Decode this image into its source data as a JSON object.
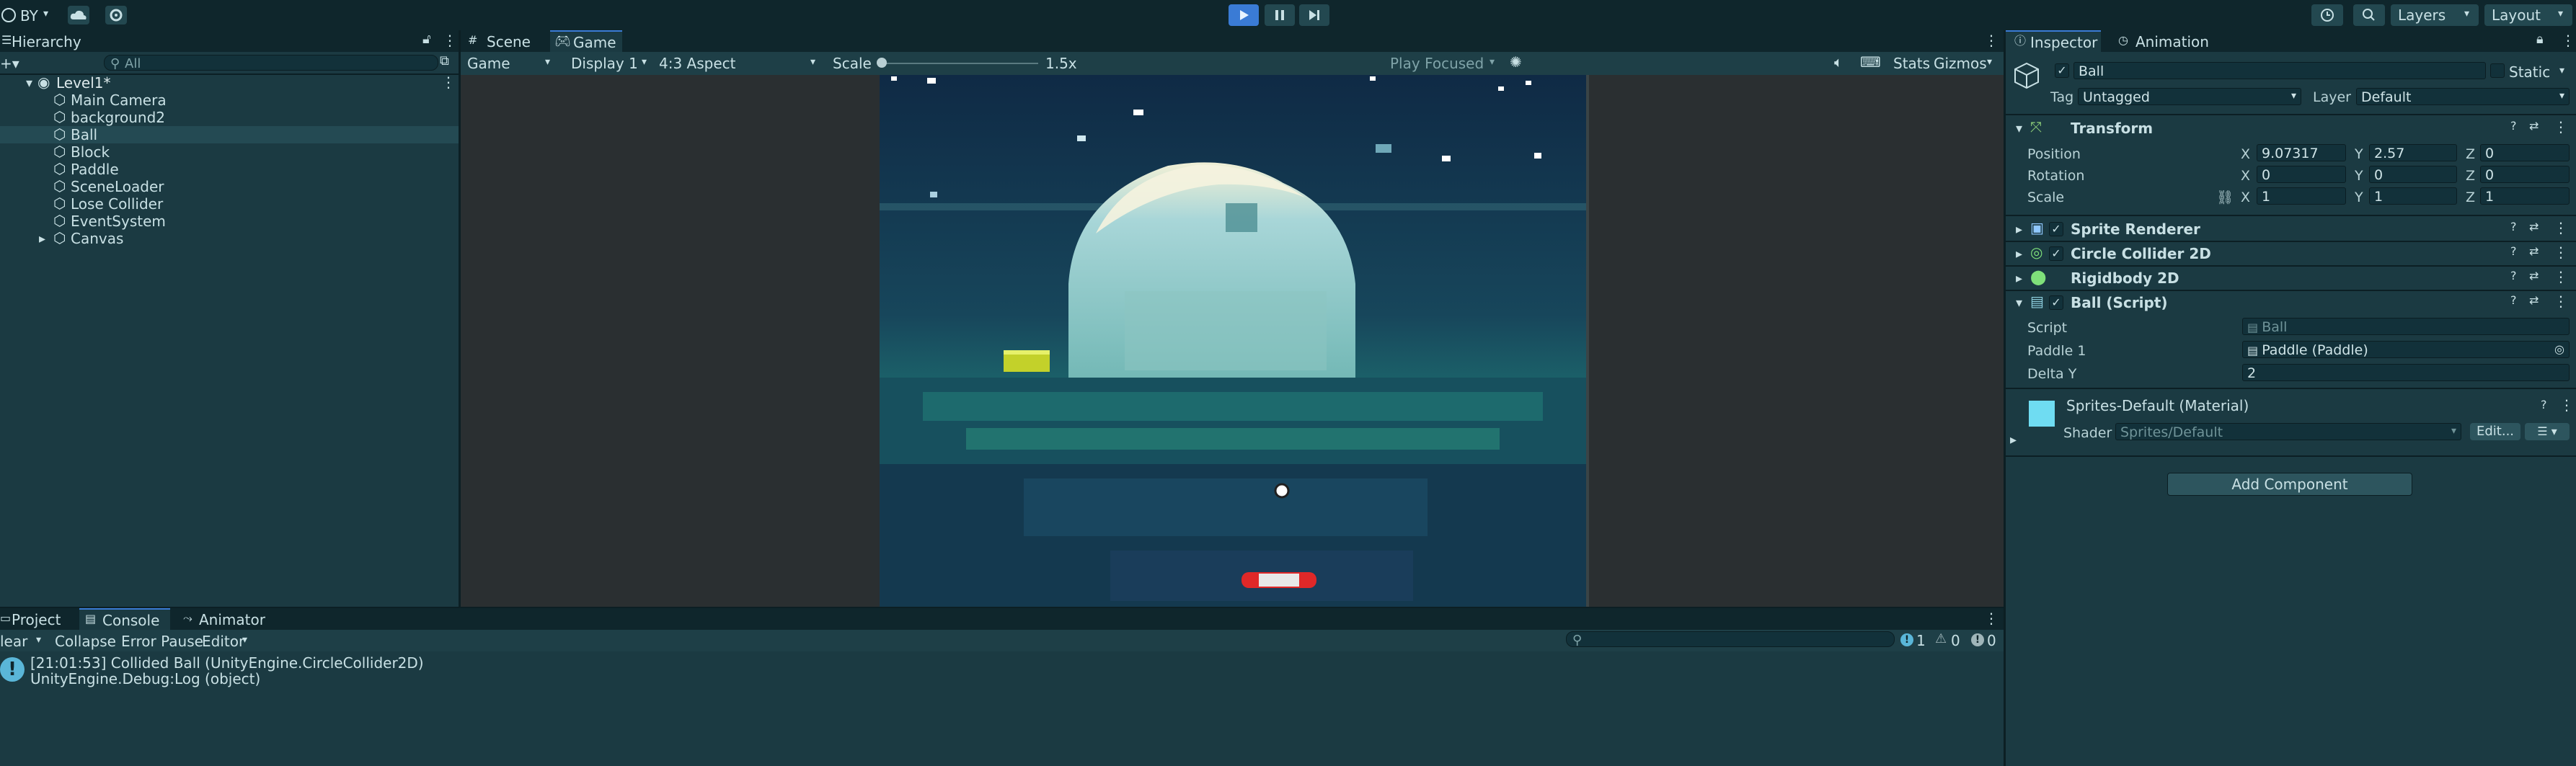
{
  "toolbar": {
    "account": "BY",
    "layers_label": "Layers",
    "layout_label": "Layout"
  },
  "hierarchy": {
    "tab_label": "Hierarchy",
    "search_placeholder": "All",
    "scene_name": "Level1*",
    "items": [
      "Main Camera",
      "background2",
      "Ball",
      "Block",
      "Paddle",
      "SceneLoader",
      "Lose Collider",
      "EventSystem",
      "Canvas"
    ]
  },
  "game_view": {
    "tabs": [
      "Scene",
      "Game"
    ],
    "mode": "Game",
    "display": "Display 1",
    "aspect": "4:3 Aspect",
    "scale_label": "Scale",
    "scale_value": "1.5x",
    "play_focused": "Play Focused",
    "stats": "Stats",
    "gizmos": "Gizmos"
  },
  "inspector": {
    "tabs": [
      "Inspector",
      "Animation"
    ],
    "object_name": "Ball",
    "static_label": "Static",
    "tag_label": "Tag",
    "tag_value": "Untagged",
    "layer_label": "Layer",
    "layer_value": "Default",
    "transform": {
      "title": "Transform",
      "position_label": "Position",
      "rotation_label": "Rotation",
      "scale_label": "Scale",
      "position": {
        "x": "9.07317",
        "y": "2.57",
        "z": "0"
      },
      "rotation": {
        "x": "0",
        "y": "0",
        "z": "0"
      },
      "scale": {
        "x": "1",
        "y": "1",
        "z": "1"
      }
    },
    "components": [
      "Sprite Renderer",
      "Circle Collider 2D",
      "Rigidbody 2D",
      "Ball (Script)"
    ],
    "script": {
      "script_label": "Script",
      "script_value": "Ball",
      "paddle_label": "Paddle 1",
      "paddle_value": "Paddle (Paddle)",
      "delta_label": "Delta Y",
      "delta_value": "2"
    },
    "material": {
      "name": "Sprites-Default (Material)",
      "shader_label": "Shader",
      "shader_value": "Sprites/Default",
      "edit_label": "Edit..."
    },
    "add_component": "Add Component"
  },
  "console": {
    "tabs": [
      "Project",
      "Console",
      "Animator"
    ],
    "clear": "lear",
    "collapse": "Collapse",
    "error_pause": "Error Pause",
    "editor": "Editor",
    "log_count": "1",
    "warn_count": "0",
    "error_count": "0",
    "message_line1": "[21:01:53] Collided Ball (UnityEngine.CircleCollider2D)",
    "message_line2": "UnityEngine.Debug:Log (object)"
  },
  "colors": {
    "accent": "#3a7bd5",
    "panel": "#1b3a42",
    "header": "#0f262c",
    "highlight": "#244a53"
  }
}
